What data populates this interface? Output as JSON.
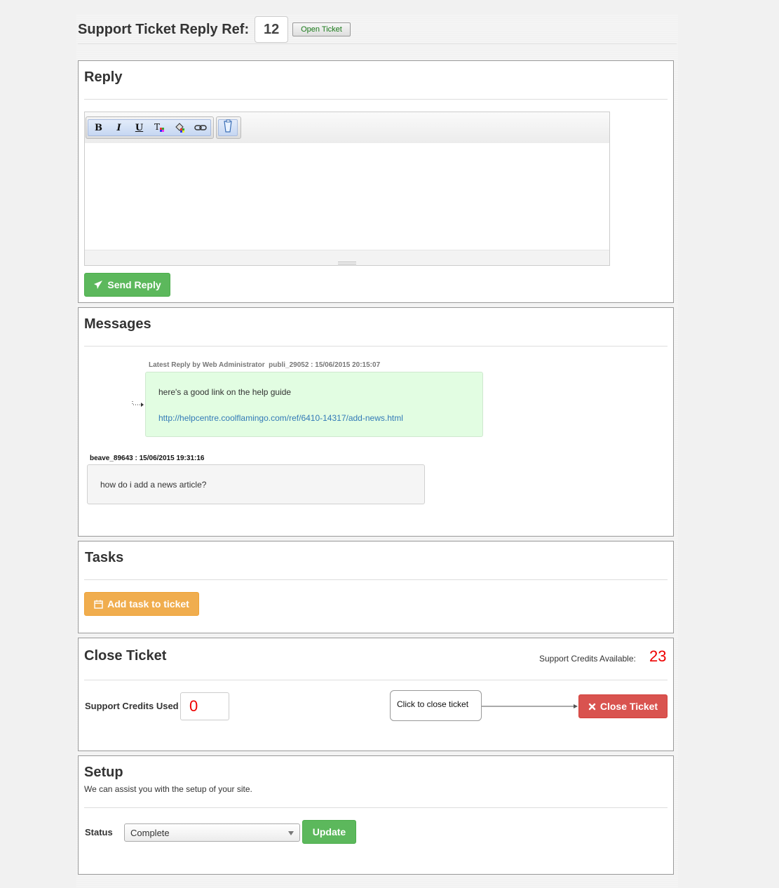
{
  "header": {
    "title": "Support Ticket Reply Ref:",
    "ref_number": "12",
    "open_ticket_label": "Open Ticket"
  },
  "reply": {
    "title": "Reply",
    "toolbar": {
      "bold": "B",
      "italic": "I",
      "underline": "U"
    },
    "send_label": "Send Reply"
  },
  "messages": {
    "title": "Messages",
    "items": [
      {
        "meta": "Latest Reply by Web Administrator  publi_29052 : 15/06/2015 20:15:07",
        "text": "here's a good link on the help guide",
        "link": "http://helpcentre.coolflamingo.com/ref/6410-14317/add-news.html"
      },
      {
        "meta": "beave_89643 : 15/06/2015 19:31:16",
        "text": "how do i add a news article?"
      }
    ]
  },
  "tasks": {
    "title": "Tasks",
    "add_label": "Add task to ticket"
  },
  "close_ticket": {
    "title": "Close Ticket",
    "credits_available_label": "Support Credits Available:",
    "credits_available": "23",
    "credits_used_label": "Support Credits Used",
    "credits_used": "0",
    "tooltip": "Click to close ticket",
    "close_label": "Close Ticket"
  },
  "setup": {
    "title": "Setup",
    "description": "We can assist you with the setup of your site.",
    "status_label": "Status",
    "status_value": "Complete",
    "update_label": "Update"
  },
  "colors": {
    "green": "#5cb85c",
    "orange": "#f0ad4e",
    "red": "#d9534f",
    "credit_value": "#ee0000"
  }
}
